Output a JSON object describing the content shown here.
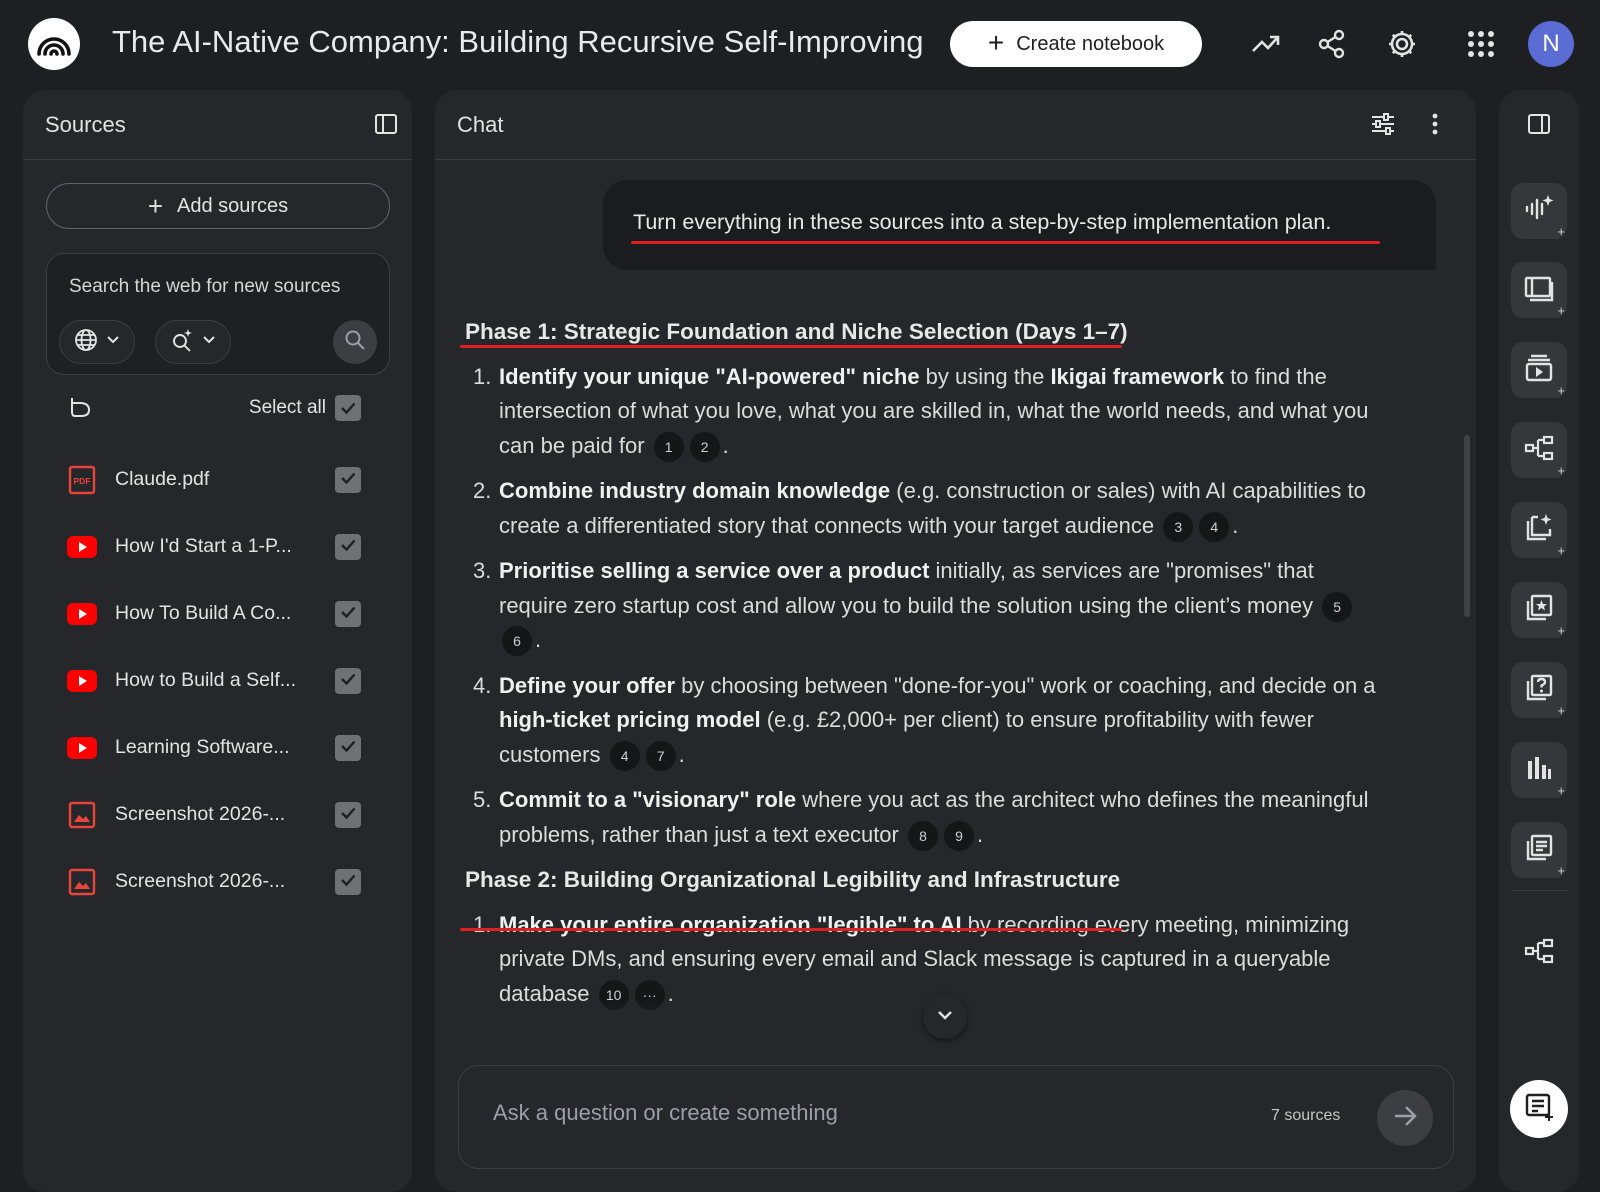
{
  "header": {
    "title": "The AI-Native Company: Building Recursive Self-Improving",
    "create_notebook": "Create notebook",
    "avatar_initial": "N"
  },
  "sources_panel": {
    "title": "Sources",
    "add_sources": "Add sources",
    "search_label": "Search the web for new sources",
    "select_all": "Select all",
    "items": [
      {
        "name": "Claude.pdf",
        "type": "pdf-icon"
      },
      {
        "name": "How I'd Start a 1-P...",
        "type": "youtube-icon"
      },
      {
        "name": "How To Build A Co...",
        "type": "youtube-icon"
      },
      {
        "name": "How to Build a Self...",
        "type": "youtube-icon"
      },
      {
        "name": "Learning Software...",
        "type": "youtube-icon"
      },
      {
        "name": "Screenshot 2026-...",
        "type": "image-icon"
      },
      {
        "name": "Screenshot 2026-...",
        "type": "image-icon"
      }
    ]
  },
  "chat_panel": {
    "title": "Chat",
    "user_message": "Turn everything in these sources into a step-by-step implementation plan.",
    "phase1": {
      "heading": "Phase 1: Strategic Foundation and Niche Selection (Days 1–7)",
      "items": [
        {
          "num": "1.",
          "b1": "Identify your unique \"AI-powered\" niche",
          "t1": " by using the ",
          "b2": "Ikigai framework",
          "t2": " to find the intersection of what you love, what you are skilled in, what the world needs, and what you can be paid for",
          "cites": [
            "1",
            "2"
          ]
        },
        {
          "num": "2.",
          "b1": "Combine industry domain knowledge",
          "t1": " (e.g. construction or sales) with AI capabilities to create a differentiated story that connects with your target audience",
          "cites": [
            "3",
            "4"
          ]
        },
        {
          "num": "3.",
          "b1": "Prioritise selling a service over a product",
          "t1": " initially, as services are \"promises\" that require zero startup cost and allow you to build the solution using the client’s money",
          "cites": [
            "5",
            "6"
          ]
        },
        {
          "num": "4.",
          "b1": "Define your offer",
          "t1": " by choosing between \"done-for-you\" work or coaching, and decide on a ",
          "b2": "high-ticket pricing model",
          "t2": " (e.g. £2,000+ per client) to ensure profitability with fewer customers",
          "cites": [
            "4",
            "7"
          ]
        },
        {
          "num": "5.",
          "b1": "Commit to a \"visionary\" role",
          "t1": " where you act as the architect who defines the meaningful problems, rather than just a text executor",
          "cites": [
            "8",
            "9"
          ]
        }
      ]
    },
    "phase2": {
      "heading": "Phase 2: Building Organizational Legibility and Infrastructure",
      "items": [
        {
          "num": "1.",
          "b1": "Make your entire organization \"legible\" to AI",
          "t1": " by recording every meeting, minimizing private DMs, and ensuring every email and Slack message is captured in a queryable database",
          "cites": [
            "10",
            "···"
          ]
        }
      ]
    },
    "input_placeholder": "Ask a question or create something",
    "source_count": "7 sources"
  },
  "colors": {
    "background": "#1e1f22",
    "panel": "#25272b",
    "annotation_red": "#e02020",
    "youtube_red": "#ff0000",
    "avatar": "#5a6bd4"
  }
}
